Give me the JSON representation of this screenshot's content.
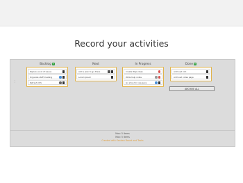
{
  "page": {
    "title": "Record your activities"
  },
  "columns": [
    {
      "name": "Backlog",
      "has_add": true,
      "cards": [
        {
          "text": "Replace a lot of issues",
          "icons": [
            "trash-icon"
          ]
        },
        {
          "text": "Organize staff meeting",
          "icons": [
            "eye-icon",
            "trash-icon"
          ]
        },
        {
          "text": "Refresh CSS",
          "icons": [
            "gear-icon",
            "trash-icon"
          ]
        }
      ]
    },
    {
      "name": "Next",
      "has_add": false,
      "cards": [
        {
          "text": "Add a plan to go there",
          "icons": [
            "calendar-icon",
            "trash-icon"
          ]
        },
        {
          "text": "Lorem ipsum",
          "icons": [
            "trash-icon"
          ]
        }
      ]
    },
    {
      "name": "In Progress",
      "has_add": false,
      "cards": [
        {
          "text": "Create Wap-ideas",
          "icons": [
            "delete-icon"
          ]
        },
        {
          "text": "Write help notes",
          "icons": [
            "timer-icon",
            "delete-icon"
          ]
        },
        {
          "text": "Go shop for new pens",
          "icons": [
            "eye-icon",
            "trash-icon"
          ]
        }
      ]
    },
    {
      "name": "Done",
      "has_add": true,
      "cards": [
        {
          "text": "Archived info",
          "icons": [
            "trash-icon"
          ]
        },
        {
          "text": "Archived notes page",
          "icons": [
            "trash-icon"
          ]
        }
      ]
    }
  ],
  "archive_button": "ARCHIVE ALL",
  "footer": {
    "line1": "Max: 5 items",
    "line2": "Max: 5 items",
    "line3": "Created with Kanban Board and Tasks"
  }
}
